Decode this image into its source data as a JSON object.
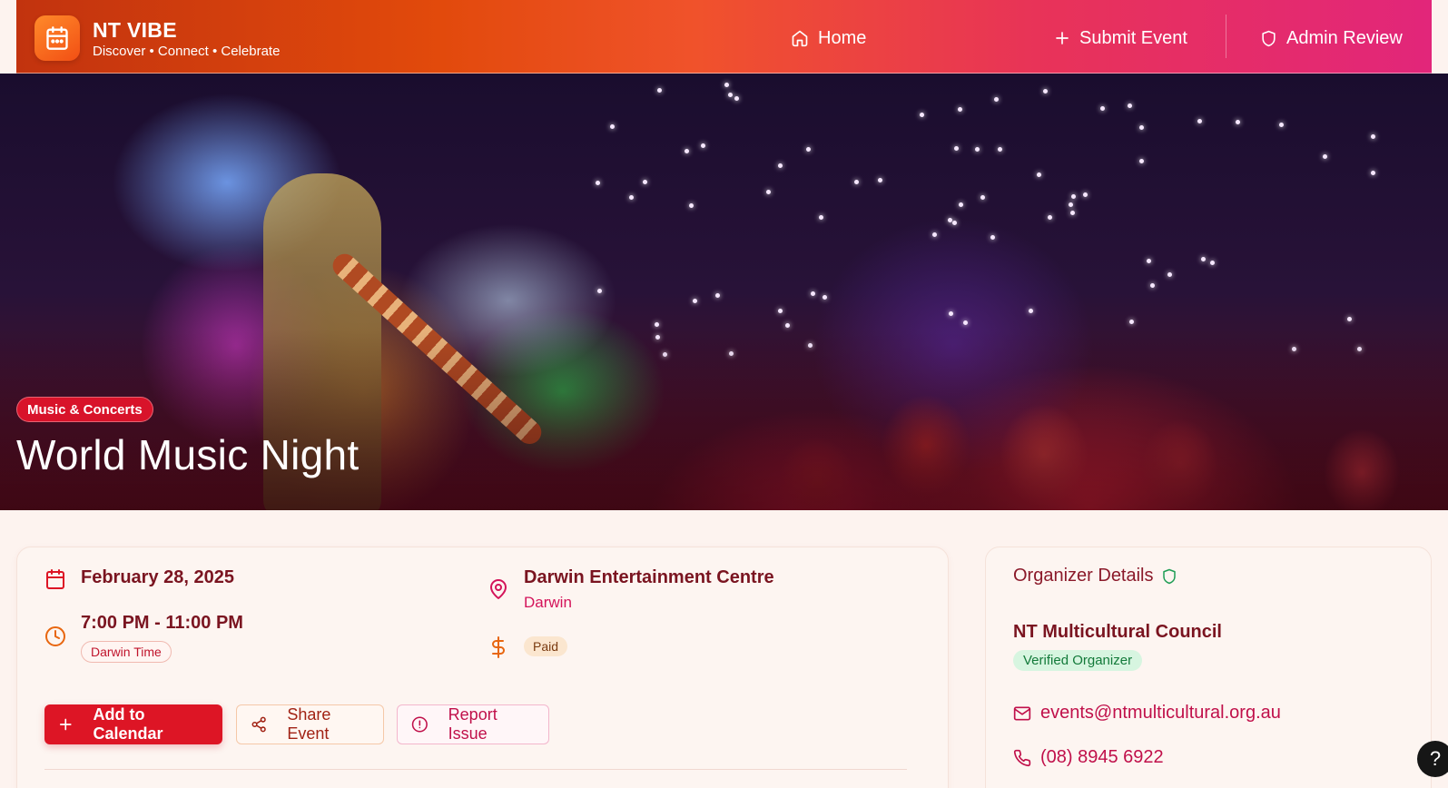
{
  "brand": {
    "name": "NT VIBE",
    "tagline": "Discover • Connect • Celebrate"
  },
  "nav": {
    "home": "Home",
    "submit": "Submit Event",
    "admin": "Admin Review"
  },
  "event": {
    "category": "Music & Concerts",
    "title": "World Music Night",
    "date": "February 28, 2025",
    "time": "7:00 PM - 11:00 PM",
    "timezone": "Darwin Time",
    "venue": "Darwin Entertainment Centre",
    "city": "Darwin",
    "price": "Paid"
  },
  "actions": {
    "add_calendar": "Add to Calendar",
    "share": "Share Event",
    "report": "Report Issue"
  },
  "organizer": {
    "heading": "Organizer Details",
    "name": "NT Multicultural Council",
    "verified": "Verified Organizer",
    "email": "events@ntmulticultural.org.au",
    "phone": "(08) 8945 6922"
  },
  "help": "?",
  "colors": {
    "primary": "#dd1525",
    "accent": "#d4145a",
    "header_start": "#c2330e",
    "header_end": "#e2267a",
    "verified": "#137a3a"
  },
  "icons": [
    "calendar-icon",
    "home-icon",
    "plus-icon",
    "shield-icon",
    "clock-icon",
    "map-pin-icon",
    "dollar-icon",
    "share-icon",
    "alert-circle-icon",
    "mail-icon",
    "phone-icon"
  ]
}
